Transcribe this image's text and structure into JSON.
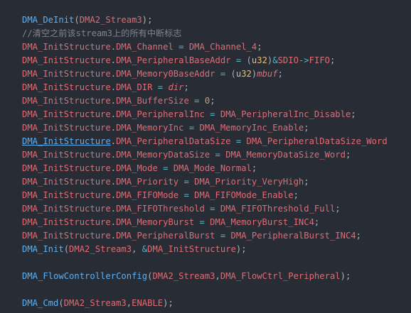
{
  "lines": [
    [
      {
        "t": "DMA_DeInit",
        "c": "fn"
      },
      {
        "t": "(",
        "c": "p"
      },
      {
        "t": "DMA2_Stream3",
        "c": "const"
      },
      {
        "t": ");",
        "c": "p"
      }
    ],
    [
      {
        "t": "//清空之前该stream3上的所有中断标志",
        "c": "cmt"
      }
    ],
    [
      {
        "t": "DMA_InitStructure",
        "c": "var"
      },
      {
        "t": ".",
        "c": "dot"
      },
      {
        "t": "DMA_Channel",
        "c": "mem"
      },
      {
        "t": " = ",
        "c": "op"
      },
      {
        "t": "DMA_Channel_4",
        "c": "const"
      },
      {
        "t": ";",
        "c": "p"
      }
    ],
    [
      {
        "t": "DMA_InitStructure",
        "c": "var"
      },
      {
        "t": ".",
        "c": "dot"
      },
      {
        "t": "DMA_PeripheralBaseAddr",
        "c": "mem"
      },
      {
        "t": " = ",
        "c": "op"
      },
      {
        "t": "(",
        "c": "p"
      },
      {
        "t": "u32",
        "c": "type"
      },
      {
        "t": ")",
        "c": "p"
      },
      {
        "t": "&",
        "c": "op"
      },
      {
        "t": "SDIO",
        "c": "const"
      },
      {
        "t": "->",
        "c": "op"
      },
      {
        "t": "FIFO",
        "c": "const"
      },
      {
        "t": ";",
        "c": "p"
      }
    ],
    [
      {
        "t": "DMA_InitStructure",
        "c": "var"
      },
      {
        "t": ".",
        "c": "dot"
      },
      {
        "t": "DMA_Memory0BaseAddr",
        "c": "mem"
      },
      {
        "t": " = ",
        "c": "op"
      },
      {
        "t": "(",
        "c": "p"
      },
      {
        "t": "u32",
        "c": "type"
      },
      {
        "t": ")",
        "c": "p"
      },
      {
        "t": "mbuf",
        "c": "param"
      },
      {
        "t": ";",
        "c": "p"
      }
    ],
    [
      {
        "t": "DMA_InitStructure",
        "c": "var"
      },
      {
        "t": ".",
        "c": "dot"
      },
      {
        "t": "DMA_DIR",
        "c": "mem"
      },
      {
        "t": " = ",
        "c": "op"
      },
      {
        "t": "dir",
        "c": "param"
      },
      {
        "t": ";",
        "c": "p"
      }
    ],
    [
      {
        "t": "DMA_InitStructure",
        "c": "var"
      },
      {
        "t": ".",
        "c": "dot"
      },
      {
        "t": "DMA_BufferSize",
        "c": "mem"
      },
      {
        "t": " = ",
        "c": "op"
      },
      {
        "t": "0",
        "c": "num"
      },
      {
        "t": ";",
        "c": "p"
      }
    ],
    [
      {
        "t": "DMA_InitStructure",
        "c": "var"
      },
      {
        "t": ".",
        "c": "dot"
      },
      {
        "t": "DMA_PeripheralInc",
        "c": "mem"
      },
      {
        "t": " = ",
        "c": "op"
      },
      {
        "t": "DMA_PeripheralInc_Disable",
        "c": "const"
      },
      {
        "t": ";",
        "c": "p"
      }
    ],
    [
      {
        "t": "DMA_InitStructure",
        "c": "var"
      },
      {
        "t": ".",
        "c": "dot"
      },
      {
        "t": "DMA_MemoryInc",
        "c": "mem"
      },
      {
        "t": " = ",
        "c": "op"
      },
      {
        "t": "DMA_MemoryInc_Enable",
        "c": "const"
      },
      {
        "t": ";",
        "c": "p"
      }
    ],
    [
      {
        "t": "DMA_InitStructure",
        "c": "fn",
        "u": true
      },
      {
        "t": ".",
        "c": "dot"
      },
      {
        "t": "DMA_PeripheralDataSize",
        "c": "mem"
      },
      {
        "t": " = ",
        "c": "op"
      },
      {
        "t": "DMA_PeripheralDataSize_Word",
        "c": "const"
      }
    ],
    [
      {
        "t": "DMA_InitStructure",
        "c": "var"
      },
      {
        "t": ".",
        "c": "dot"
      },
      {
        "t": "DMA_MemoryDataSize",
        "c": "mem"
      },
      {
        "t": " = ",
        "c": "op"
      },
      {
        "t": "DMA_MemoryDataSize_Word",
        "c": "const"
      },
      {
        "t": ";",
        "c": "p"
      }
    ],
    [
      {
        "t": "DMA_InitStructure",
        "c": "var"
      },
      {
        "t": ".",
        "c": "dot"
      },
      {
        "t": "DMA_Mode",
        "c": "mem"
      },
      {
        "t": " = ",
        "c": "op"
      },
      {
        "t": "DMA_Mode_Normal",
        "c": "const"
      },
      {
        "t": ";",
        "c": "p"
      }
    ],
    [
      {
        "t": "DMA_InitStructure",
        "c": "var"
      },
      {
        "t": ".",
        "c": "dot"
      },
      {
        "t": "DMA_Priority",
        "c": "mem"
      },
      {
        "t": " = ",
        "c": "op"
      },
      {
        "t": "DMA_Priority_VeryHigh",
        "c": "const"
      },
      {
        "t": ";",
        "c": "p"
      }
    ],
    [
      {
        "t": "DMA_InitStructure",
        "c": "var"
      },
      {
        "t": ".",
        "c": "dot"
      },
      {
        "t": "DMA_FIFOMode",
        "c": "mem"
      },
      {
        "t": " = ",
        "c": "op"
      },
      {
        "t": "DMA_FIFOMode_Enable",
        "c": "const"
      },
      {
        "t": ";",
        "c": "p"
      }
    ],
    [
      {
        "t": "DMA_InitStructure",
        "c": "var"
      },
      {
        "t": ".",
        "c": "dot"
      },
      {
        "t": "DMA_FIFOThreshold",
        "c": "mem"
      },
      {
        "t": " = ",
        "c": "op"
      },
      {
        "t": "DMA_FIFOThreshold_Full",
        "c": "const"
      },
      {
        "t": ";",
        "c": "p"
      }
    ],
    [
      {
        "t": "DMA_InitStructure",
        "c": "var"
      },
      {
        "t": ".",
        "c": "dot"
      },
      {
        "t": "DMA_MemoryBurst",
        "c": "mem"
      },
      {
        "t": " = ",
        "c": "op"
      },
      {
        "t": "DMA_MemoryBurst_INC4",
        "c": "const"
      },
      {
        "t": ";",
        "c": "p"
      }
    ],
    [
      {
        "t": "DMA_InitStructure",
        "c": "var"
      },
      {
        "t": ".",
        "c": "dot"
      },
      {
        "t": "DMA_PeripheralBurst",
        "c": "mem"
      },
      {
        "t": " = ",
        "c": "op"
      },
      {
        "t": "DMA_PeripheralBurst_INC4",
        "c": "const"
      },
      {
        "t": ";",
        "c": "p"
      }
    ],
    [
      {
        "t": "DMA_Init",
        "c": "fn"
      },
      {
        "t": "(",
        "c": "p"
      },
      {
        "t": "DMA2_Stream3",
        "c": "const"
      },
      {
        "t": ", ",
        "c": "p"
      },
      {
        "t": "&",
        "c": "op"
      },
      {
        "t": "DMA_InitStructure",
        "c": "var"
      },
      {
        "t": ");",
        "c": "p"
      }
    ],
    [],
    [
      {
        "t": "DMA_FlowControllerConfig",
        "c": "fn"
      },
      {
        "t": "(",
        "c": "p"
      },
      {
        "t": "DMA2_Stream3",
        "c": "const"
      },
      {
        "t": ",",
        "c": "p"
      },
      {
        "t": "DMA_FlowCtrl_Peripheral",
        "c": "const"
      },
      {
        "t": ");",
        "c": "p"
      }
    ],
    [],
    [
      {
        "t": "DMA_Cmd",
        "c": "fn"
      },
      {
        "t": "(",
        "c": "p"
      },
      {
        "t": "DMA2_Stream3",
        "c": "const"
      },
      {
        "t": ",",
        "c": "p"
      },
      {
        "t": "ENABLE",
        "c": "const"
      },
      {
        "t": ");",
        "c": "p"
      }
    ]
  ]
}
